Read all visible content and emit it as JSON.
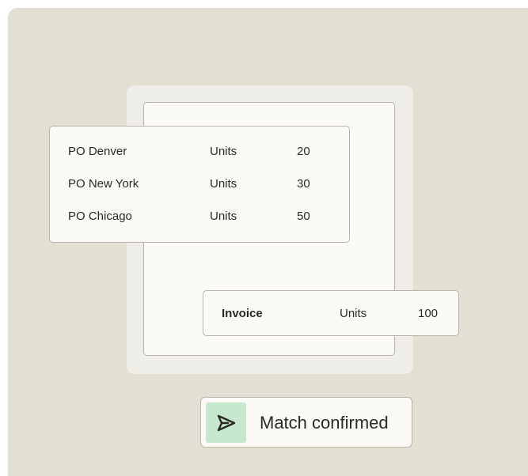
{
  "purchase_orders": [
    {
      "name": "PO Denver",
      "unit_label": "Units",
      "quantity": "20"
    },
    {
      "name": "PO New York",
      "unit_label": "Units",
      "quantity": "30"
    },
    {
      "name": "PO Chicago",
      "unit_label": "Units",
      "quantity": "50"
    }
  ],
  "invoice": {
    "label": "Invoice",
    "unit_label": "Units",
    "quantity": "100"
  },
  "status": {
    "icon": "send-icon",
    "text": "Match confirmed"
  },
  "colors": {
    "background": "#e3dfd3",
    "panel": "#eeede8",
    "card": "#fbfaf6",
    "border": "#b7b4ab",
    "icon_bg": "#c6e8cf",
    "text": "#2b2926"
  }
}
